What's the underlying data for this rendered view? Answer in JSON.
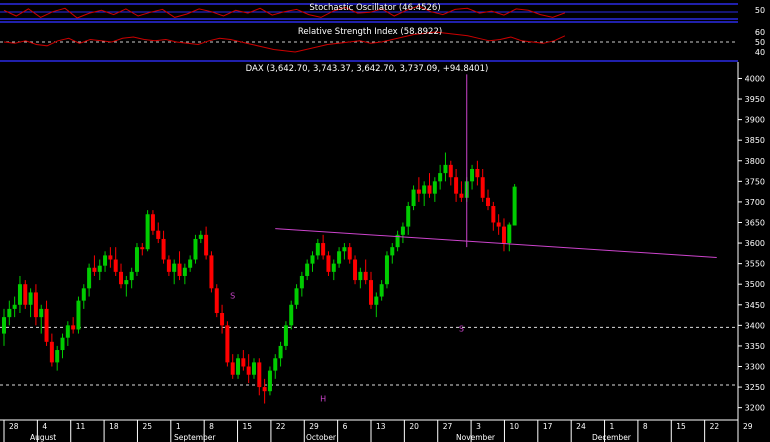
{
  "panels": {
    "stochastic": {
      "label": "Stochastic Oscillator (46.4526)",
      "ticks": [
        "50"
      ],
      "line_color": "#cc0000",
      "series": [
        55,
        35,
        60,
        30,
        50,
        62,
        28,
        45,
        55,
        40,
        60,
        35,
        48,
        58,
        30,
        42,
        60,
        50,
        35,
        55,
        45,
        62,
        38,
        50,
        58,
        40,
        30,
        52,
        65,
        45,
        48,
        60,
        35,
        55,
        70,
        50,
        40,
        58,
        62,
        45,
        52,
        38,
        60,
        55,
        40,
        30,
        46
      ]
    },
    "rsi": {
      "label": "Relative Strength Index (58.8922)",
      "ticks": [
        "60",
        "50",
        "40"
      ],
      "line_color": "#cc0000",
      "series": [
        54,
        53,
        55,
        52,
        51,
        55,
        57,
        53,
        56,
        55,
        54,
        57,
        58,
        56,
        55,
        56,
        54,
        53,
        52,
        55,
        57,
        56,
        54,
        52,
        50,
        48,
        47,
        46,
        48,
        50,
        52,
        53,
        54,
        55,
        53,
        54,
        56,
        58,
        60,
        61,
        62,
        61,
        60,
        59,
        57,
        55,
        56,
        58,
        55,
        54,
        53,
        55,
        59
      ]
    }
  },
  "chart_data": {
    "type": "candlestick",
    "title": "DAX (3,642.70, 3,743.37, 3,642.70, 3,737.09, +94.8401)",
    "ylim": [
      3170,
      4040
    ],
    "y_ticks": [
      3200,
      3250,
      3300,
      3350,
      3400,
      3450,
      3500,
      3550,
      3600,
      3650,
      3700,
      3750,
      3800,
      3850,
      3900,
      3950,
      4000
    ],
    "x_tick_labels": [
      "28",
      "4",
      "11",
      "18",
      "25",
      "1",
      "8",
      "15",
      "22",
      "29",
      "6",
      "13",
      "20",
      "27",
      "3",
      "10",
      "17",
      "24",
      "1",
      "8",
      "15",
      "22",
      "29"
    ],
    "month_labels": [
      "August",
      "September",
      "October",
      "November",
      "December"
    ],
    "colors": {
      "up": "#00cc00",
      "down": "#ff0000",
      "trendline": "#cc44cc",
      "annotation": "#cc44cc"
    },
    "reference_lines": [
      3395,
      3255
    ],
    "trendline": {
      "from": {
        "bar": 51,
        "value": 3635
      },
      "to": {
        "bar": 134,
        "value": 3565
      }
    },
    "spike": {
      "bar": 87,
      "low": 3590,
      "high": 4010
    },
    "annotations": [
      {
        "text": "S",
        "bar": 43,
        "value": 3465
      },
      {
        "text": "H",
        "bar": 60,
        "value": 3215
      },
      {
        "text": "S",
        "bar": 86,
        "value": 3385
      }
    ],
    "candles": [
      {
        "o": 3380,
        "h": 3440,
        "l": 3350,
        "c": 3420
      },
      {
        "o": 3420,
        "h": 3460,
        "l": 3400,
        "c": 3440
      },
      {
        "o": 3440,
        "h": 3470,
        "l": 3420,
        "c": 3450
      },
      {
        "o": 3450,
        "h": 3520,
        "l": 3430,
        "c": 3500
      },
      {
        "o": 3500,
        "h": 3510,
        "l": 3440,
        "c": 3450
      },
      {
        "o": 3450,
        "h": 3490,
        "l": 3420,
        "c": 3480
      },
      {
        "o": 3480,
        "h": 3500,
        "l": 3400,
        "c": 3420
      },
      {
        "o": 3420,
        "h": 3450,
        "l": 3380,
        "c": 3440
      },
      {
        "o": 3440,
        "h": 3460,
        "l": 3350,
        "c": 3360
      },
      {
        "o": 3360,
        "h": 3380,
        "l": 3300,
        "c": 3310
      },
      {
        "o": 3310,
        "h": 3350,
        "l": 3290,
        "c": 3340
      },
      {
        "o": 3340,
        "h": 3380,
        "l": 3320,
        "c": 3370
      },
      {
        "o": 3370,
        "h": 3410,
        "l": 3350,
        "c": 3400
      },
      {
        "o": 3400,
        "h": 3420,
        "l": 3380,
        "c": 3390
      },
      {
        "o": 3390,
        "h": 3470,
        "l": 3380,
        "c": 3460
      },
      {
        "o": 3460,
        "h": 3500,
        "l": 3440,
        "c": 3490
      },
      {
        "o": 3490,
        "h": 3550,
        "l": 3470,
        "c": 3540
      },
      {
        "o": 3540,
        "h": 3570,
        "l": 3520,
        "c": 3530
      },
      {
        "o": 3530,
        "h": 3560,
        "l": 3510,
        "c": 3545
      },
      {
        "o": 3545,
        "h": 3580,
        "l": 3530,
        "c": 3570
      },
      {
        "o": 3570,
        "h": 3590,
        "l": 3540,
        "c": 3560
      },
      {
        "o": 3560,
        "h": 3590,
        "l": 3520,
        "c": 3530
      },
      {
        "o": 3530,
        "h": 3550,
        "l": 3490,
        "c": 3500
      },
      {
        "o": 3500,
        "h": 3520,
        "l": 3470,
        "c": 3510
      },
      {
        "o": 3510,
        "h": 3540,
        "l": 3490,
        "c": 3530
      },
      {
        "o": 3530,
        "h": 3600,
        "l": 3520,
        "c": 3590
      },
      {
        "o": 3590,
        "h": 3600,
        "l": 3570,
        "c": 3585
      },
      {
        "o": 3585,
        "h": 3680,
        "l": 3580,
        "c": 3670
      },
      {
        "o": 3670,
        "h": 3680,
        "l": 3620,
        "c": 3630
      },
      {
        "o": 3630,
        "h": 3650,
        "l": 3600,
        "c": 3610
      },
      {
        "o": 3610,
        "h": 3630,
        "l": 3550,
        "c": 3560
      },
      {
        "o": 3560,
        "h": 3570,
        "l": 3520,
        "c": 3530
      },
      {
        "o": 3530,
        "h": 3560,
        "l": 3500,
        "c": 3550
      },
      {
        "o": 3550,
        "h": 3580,
        "l": 3510,
        "c": 3520
      },
      {
        "o": 3520,
        "h": 3550,
        "l": 3500,
        "c": 3540
      },
      {
        "o": 3540,
        "h": 3570,
        "l": 3530,
        "c": 3560
      },
      {
        "o": 3560,
        "h": 3620,
        "l": 3550,
        "c": 3610
      },
      {
        "o": 3610,
        "h": 3630,
        "l": 3600,
        "c": 3620
      },
      {
        "o": 3620,
        "h": 3640,
        "l": 3560,
        "c": 3570
      },
      {
        "o": 3570,
        "h": 3580,
        "l": 3480,
        "c": 3490
      },
      {
        "o": 3490,
        "h": 3500,
        "l": 3420,
        "c": 3430
      },
      {
        "o": 3430,
        "h": 3450,
        "l": 3380,
        "c": 3400
      },
      {
        "o": 3400,
        "h": 3410,
        "l": 3300,
        "c": 3310
      },
      {
        "o": 3310,
        "h": 3330,
        "l": 3270,
        "c": 3280
      },
      {
        "o": 3280,
        "h": 3330,
        "l": 3270,
        "c": 3320
      },
      {
        "o": 3320,
        "h": 3340,
        "l": 3290,
        "c": 3300
      },
      {
        "o": 3300,
        "h": 3330,
        "l": 3260,
        "c": 3280
      },
      {
        "o": 3280,
        "h": 3320,
        "l": 3270,
        "c": 3310
      },
      {
        "o": 3310,
        "h": 3320,
        "l": 3230,
        "c": 3250
      },
      {
        "o": 3250,
        "h": 3270,
        "l": 3210,
        "c": 3240
      },
      {
        "o": 3240,
        "h": 3300,
        "l": 3230,
        "c": 3290
      },
      {
        "o": 3290,
        "h": 3330,
        "l": 3270,
        "c": 3320
      },
      {
        "o": 3320,
        "h": 3360,
        "l": 3300,
        "c": 3350
      },
      {
        "o": 3350,
        "h": 3410,
        "l": 3340,
        "c": 3400
      },
      {
        "o": 3400,
        "h": 3460,
        "l": 3390,
        "c": 3450
      },
      {
        "o": 3450,
        "h": 3500,
        "l": 3440,
        "c": 3490
      },
      {
        "o": 3490,
        "h": 3530,
        "l": 3470,
        "c": 3520
      },
      {
        "o": 3520,
        "h": 3560,
        "l": 3510,
        "c": 3550
      },
      {
        "o": 3550,
        "h": 3580,
        "l": 3530,
        "c": 3570
      },
      {
        "o": 3570,
        "h": 3610,
        "l": 3560,
        "c": 3600
      },
      {
        "o": 3600,
        "h": 3620,
        "l": 3560,
        "c": 3570
      },
      {
        "o": 3570,
        "h": 3580,
        "l": 3520,
        "c": 3530
      },
      {
        "o": 3530,
        "h": 3560,
        "l": 3510,
        "c": 3550
      },
      {
        "o": 3550,
        "h": 3590,
        "l": 3540,
        "c": 3580
      },
      {
        "o": 3580,
        "h": 3600,
        "l": 3560,
        "c": 3590
      },
      {
        "o": 3590,
        "h": 3600,
        "l": 3550,
        "c": 3560
      },
      {
        "o": 3560,
        "h": 3570,
        "l": 3500,
        "c": 3510
      },
      {
        "o": 3510,
        "h": 3540,
        "l": 3490,
        "c": 3530
      },
      {
        "o": 3530,
        "h": 3560,
        "l": 3500,
        "c": 3510
      },
      {
        "o": 3510,
        "h": 3530,
        "l": 3440,
        "c": 3450
      },
      {
        "o": 3450,
        "h": 3480,
        "l": 3420,
        "c": 3470
      },
      {
        "o": 3470,
        "h": 3510,
        "l": 3460,
        "c": 3500
      },
      {
        "o": 3500,
        "h": 3580,
        "l": 3490,
        "c": 3570
      },
      {
        "o": 3570,
        "h": 3600,
        "l": 3550,
        "c": 3590
      },
      {
        "o": 3590,
        "h": 3630,
        "l": 3580,
        "c": 3620
      },
      {
        "o": 3620,
        "h": 3650,
        "l": 3600,
        "c": 3640
      },
      {
        "o": 3640,
        "h": 3700,
        "l": 3620,
        "c": 3690
      },
      {
        "o": 3690,
        "h": 3740,
        "l": 3680,
        "c": 3730
      },
      {
        "o": 3730,
        "h": 3760,
        "l": 3700,
        "c": 3720
      },
      {
        "o": 3720,
        "h": 3750,
        "l": 3690,
        "c": 3740
      },
      {
        "o": 3740,
        "h": 3770,
        "l": 3710,
        "c": 3720
      },
      {
        "o": 3720,
        "h": 3760,
        "l": 3700,
        "c": 3750
      },
      {
        "o": 3750,
        "h": 3790,
        "l": 3730,
        "c": 3770
      },
      {
        "o": 3770,
        "h": 3820,
        "l": 3750,
        "c": 3790
      },
      {
        "o": 3790,
        "h": 3800,
        "l": 3740,
        "c": 3760
      },
      {
        "o": 3760,
        "h": 3780,
        "l": 3700,
        "c": 3720
      },
      {
        "o": 3720,
        "h": 3750,
        "l": 3700,
        "c": 3710
      },
      {
        "o": 3710,
        "h": 3760,
        "l": 3700,
        "c": 3750
      },
      {
        "o": 3750,
        "h": 3790,
        "l": 3730,
        "c": 3780
      },
      {
        "o": 3780,
        "h": 3800,
        "l": 3740,
        "c": 3760
      },
      {
        "o": 3760,
        "h": 3780,
        "l": 3700,
        "c": 3710
      },
      {
        "o": 3710,
        "h": 3730,
        "l": 3680,
        "c": 3690
      },
      {
        "o": 3690,
        "h": 3700,
        "l": 3630,
        "c": 3650
      },
      {
        "o": 3650,
        "h": 3670,
        "l": 3620,
        "c": 3640
      },
      {
        "o": 3640,
        "h": 3660,
        "l": 3580,
        "c": 3600
      },
      {
        "o": 3600,
        "h": 3650,
        "l": 3580,
        "c": 3645
      },
      {
        "o": 3642.7,
        "h": 3743.37,
        "l": 3642.7,
        "c": 3737.09
      }
    ]
  }
}
